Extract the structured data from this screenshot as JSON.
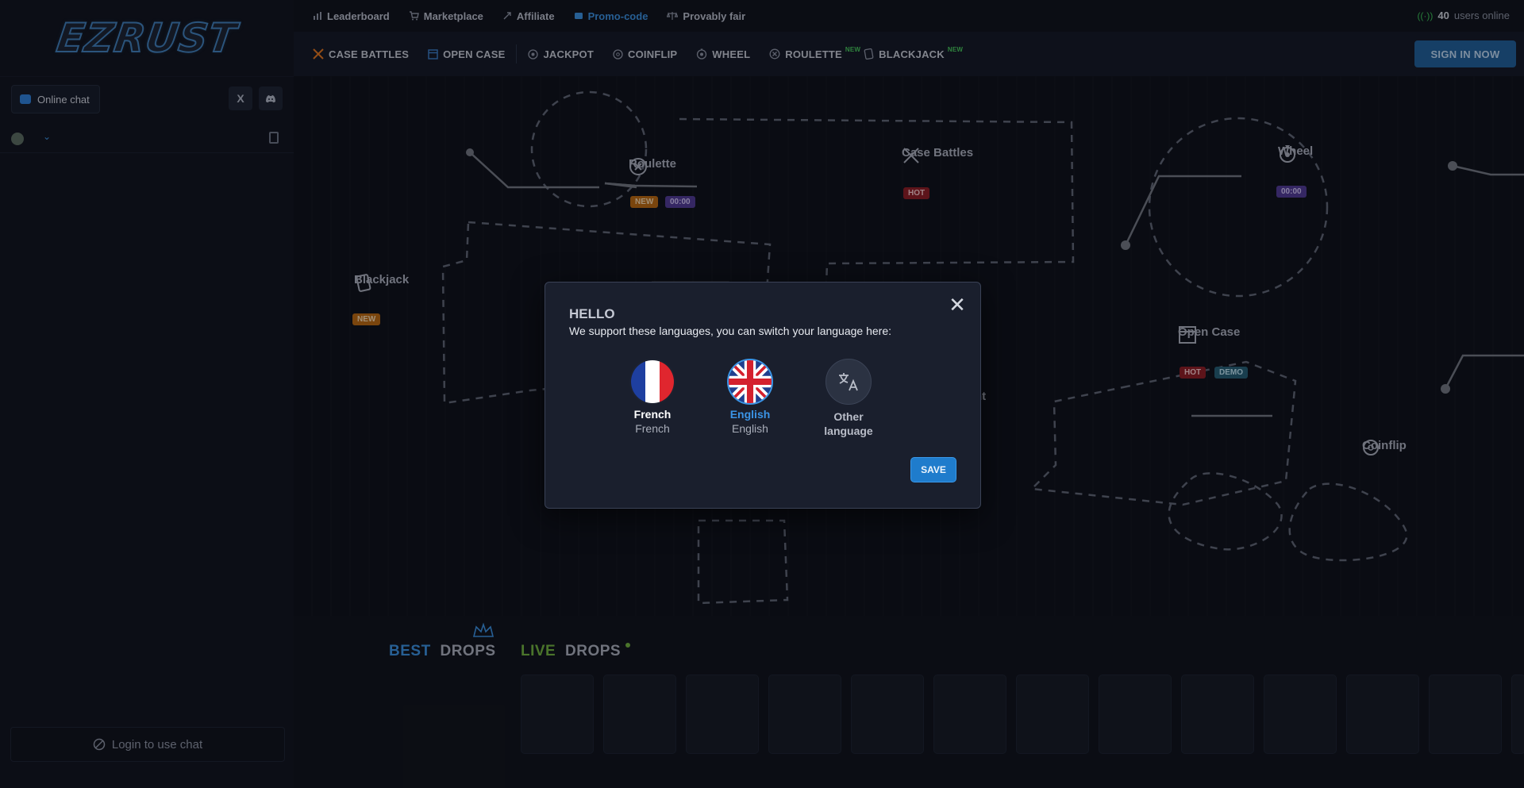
{
  "brand": {
    "logo": "EZRUST"
  },
  "topnav": [
    {
      "label": "Leaderboard",
      "icon": "bar-chart-icon"
    },
    {
      "label": "Marketplace",
      "icon": "cart-icon"
    },
    {
      "label": "Affiliate",
      "icon": "link-icon"
    },
    {
      "label": "Promo-code",
      "icon": "ticket-icon"
    },
    {
      "label": "Provably fair",
      "icon": "scale-icon"
    }
  ],
  "online": {
    "count": "40",
    "label": "users online"
  },
  "games": [
    {
      "label": "CASE BATTLES"
    },
    {
      "label": "OPEN CASE"
    },
    {
      "label": "JACKPOT"
    },
    {
      "label": "COINFLIP"
    },
    {
      "label": "WHEEL"
    },
    {
      "label": "ROULETTE",
      "new": "NEW"
    },
    {
      "label": "BLACKJACK",
      "new": "NEW"
    }
  ],
  "signin": "SIGN IN NOW",
  "chat": {
    "tab": "Online chat",
    "x_label": "X",
    "login": "Login to use chat",
    "collapse": "‹"
  },
  "map": {
    "roulette": {
      "label": "Roulette",
      "badge_new": "NEW",
      "badge_time": "00:00"
    },
    "case_battles": {
      "label": "Case Battles",
      "badge_hot": "HOT"
    },
    "wheel": {
      "label": "Wheel",
      "badge_time": "00:00"
    },
    "blackjack": {
      "label": "Blackjack",
      "badge_new": "NEW"
    },
    "open_case": {
      "label": "Open Case",
      "badge_hot": "HOT",
      "badge_demo": "DEMO"
    },
    "jackpot_partial": "nt",
    "coinflip": {
      "label": "Coinflip"
    }
  },
  "drops": {
    "best_a": "BEST",
    "best_b": "DROPS",
    "live_a": "LIVE",
    "live_b": "DROPS"
  },
  "modal": {
    "title": "HELLO",
    "subtitle": "We support these languages, you can switch your language here:",
    "languages": [
      {
        "name": "French",
        "native": "French"
      },
      {
        "name": "English",
        "native": "English"
      },
      {
        "name": "Other language"
      }
    ],
    "save": "SAVE",
    "close": "✕"
  },
  "colors": {
    "accent": "#2d7fd6",
    "new": "#46c659",
    "hot": "#8c1c22"
  }
}
